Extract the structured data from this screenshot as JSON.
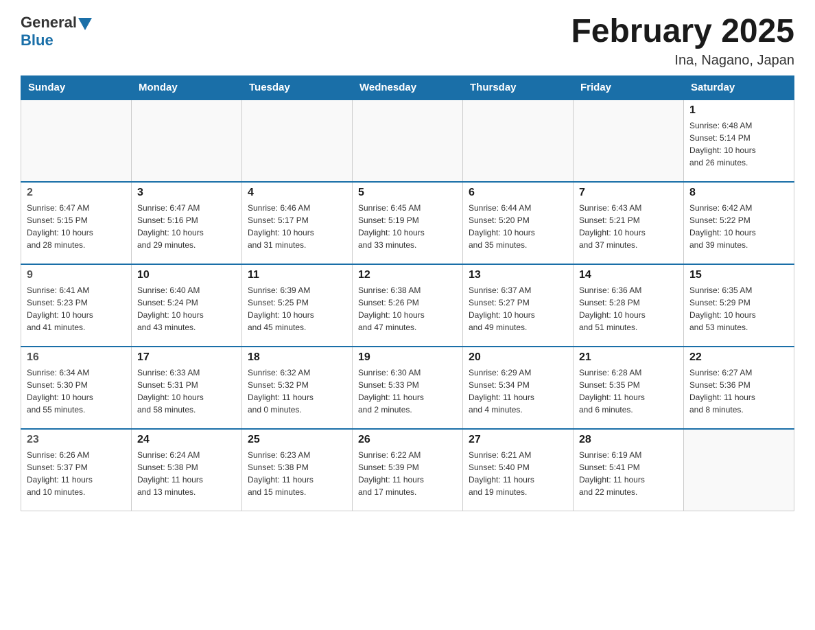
{
  "header": {
    "logo_general": "General",
    "logo_blue": "Blue",
    "title": "February 2025",
    "subtitle": "Ina, Nagano, Japan"
  },
  "days_of_week": [
    "Sunday",
    "Monday",
    "Tuesday",
    "Wednesday",
    "Thursday",
    "Friday",
    "Saturday"
  ],
  "weeks": [
    [
      {
        "num": "",
        "info": ""
      },
      {
        "num": "",
        "info": ""
      },
      {
        "num": "",
        "info": ""
      },
      {
        "num": "",
        "info": ""
      },
      {
        "num": "",
        "info": ""
      },
      {
        "num": "",
        "info": ""
      },
      {
        "num": "1",
        "info": "Sunrise: 6:48 AM\nSunset: 5:14 PM\nDaylight: 10 hours\nand 26 minutes."
      }
    ],
    [
      {
        "num": "2",
        "info": "Sunrise: 6:47 AM\nSunset: 5:15 PM\nDaylight: 10 hours\nand 28 minutes."
      },
      {
        "num": "3",
        "info": "Sunrise: 6:47 AM\nSunset: 5:16 PM\nDaylight: 10 hours\nand 29 minutes."
      },
      {
        "num": "4",
        "info": "Sunrise: 6:46 AM\nSunset: 5:17 PM\nDaylight: 10 hours\nand 31 minutes."
      },
      {
        "num": "5",
        "info": "Sunrise: 6:45 AM\nSunset: 5:19 PM\nDaylight: 10 hours\nand 33 minutes."
      },
      {
        "num": "6",
        "info": "Sunrise: 6:44 AM\nSunset: 5:20 PM\nDaylight: 10 hours\nand 35 minutes."
      },
      {
        "num": "7",
        "info": "Sunrise: 6:43 AM\nSunset: 5:21 PM\nDaylight: 10 hours\nand 37 minutes."
      },
      {
        "num": "8",
        "info": "Sunrise: 6:42 AM\nSunset: 5:22 PM\nDaylight: 10 hours\nand 39 minutes."
      }
    ],
    [
      {
        "num": "9",
        "info": "Sunrise: 6:41 AM\nSunset: 5:23 PM\nDaylight: 10 hours\nand 41 minutes."
      },
      {
        "num": "10",
        "info": "Sunrise: 6:40 AM\nSunset: 5:24 PM\nDaylight: 10 hours\nand 43 minutes."
      },
      {
        "num": "11",
        "info": "Sunrise: 6:39 AM\nSunset: 5:25 PM\nDaylight: 10 hours\nand 45 minutes."
      },
      {
        "num": "12",
        "info": "Sunrise: 6:38 AM\nSunset: 5:26 PM\nDaylight: 10 hours\nand 47 minutes."
      },
      {
        "num": "13",
        "info": "Sunrise: 6:37 AM\nSunset: 5:27 PM\nDaylight: 10 hours\nand 49 minutes."
      },
      {
        "num": "14",
        "info": "Sunrise: 6:36 AM\nSunset: 5:28 PM\nDaylight: 10 hours\nand 51 minutes."
      },
      {
        "num": "15",
        "info": "Sunrise: 6:35 AM\nSunset: 5:29 PM\nDaylight: 10 hours\nand 53 minutes."
      }
    ],
    [
      {
        "num": "16",
        "info": "Sunrise: 6:34 AM\nSunset: 5:30 PM\nDaylight: 10 hours\nand 55 minutes."
      },
      {
        "num": "17",
        "info": "Sunrise: 6:33 AM\nSunset: 5:31 PM\nDaylight: 10 hours\nand 58 minutes."
      },
      {
        "num": "18",
        "info": "Sunrise: 6:32 AM\nSunset: 5:32 PM\nDaylight: 11 hours\nand 0 minutes."
      },
      {
        "num": "19",
        "info": "Sunrise: 6:30 AM\nSunset: 5:33 PM\nDaylight: 11 hours\nand 2 minutes."
      },
      {
        "num": "20",
        "info": "Sunrise: 6:29 AM\nSunset: 5:34 PM\nDaylight: 11 hours\nand 4 minutes."
      },
      {
        "num": "21",
        "info": "Sunrise: 6:28 AM\nSunset: 5:35 PM\nDaylight: 11 hours\nand 6 minutes."
      },
      {
        "num": "22",
        "info": "Sunrise: 6:27 AM\nSunset: 5:36 PM\nDaylight: 11 hours\nand 8 minutes."
      }
    ],
    [
      {
        "num": "23",
        "info": "Sunrise: 6:26 AM\nSunset: 5:37 PM\nDaylight: 11 hours\nand 10 minutes."
      },
      {
        "num": "24",
        "info": "Sunrise: 6:24 AM\nSunset: 5:38 PM\nDaylight: 11 hours\nand 13 minutes."
      },
      {
        "num": "25",
        "info": "Sunrise: 6:23 AM\nSunset: 5:38 PM\nDaylight: 11 hours\nand 15 minutes."
      },
      {
        "num": "26",
        "info": "Sunrise: 6:22 AM\nSunset: 5:39 PM\nDaylight: 11 hours\nand 17 minutes."
      },
      {
        "num": "27",
        "info": "Sunrise: 6:21 AM\nSunset: 5:40 PM\nDaylight: 11 hours\nand 19 minutes."
      },
      {
        "num": "28",
        "info": "Sunrise: 6:19 AM\nSunset: 5:41 PM\nDaylight: 11 hours\nand 22 minutes."
      },
      {
        "num": "",
        "info": ""
      }
    ]
  ]
}
